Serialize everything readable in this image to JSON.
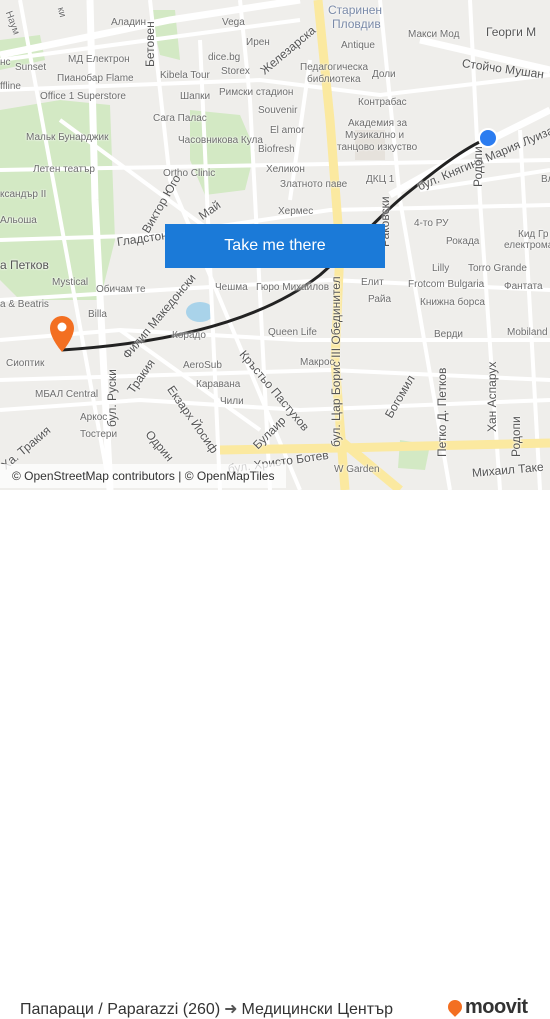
{
  "map": {
    "labels": {
      "naum": "Наум",
      "aladin": "Аладин",
      "betoven": "Бетовен",
      "vega": "Vega",
      "iren": "Ирен",
      "starinen": "Старинен",
      "plovdiv": "Пловдив",
      "maksi": "Макси Мод",
      "georgi": "Георги М",
      "stoycho": "Стойчо Мушан",
      "md": "МД Електрон",
      "sunset": "Sunset",
      "pianobar": "Пианобар Flame",
      "kibela": "Kibela Tour",
      "dice": "dice.bg",
      "storex": "Storex",
      "zhelezarska": "Железарска",
      "antique": "Antique",
      "ped1": "Педагогическа",
      "ped2": "библиотека",
      "doli": "Доли",
      "office1": "Office 1 Superstore",
      "shapki": "Шапки",
      "rimski": "Римски стадион",
      "souvenir": "Souvenir",
      "kontrabas": "Контрабас",
      "saga": "Сага Палас",
      "akad1": "Академия за",
      "akad2": "Музикално и",
      "akad3": "танцово изкуство",
      "malak": "Мальк Бунарджик",
      "chasovnikova": "Часовникова Кула",
      "elamor": "El amor",
      "biofresh": "Biofresh",
      "leten": "Летен театър",
      "ortho": "Ortho Clinic",
      "helikon": "Хеликон",
      "zlatnoto": "Златното паве",
      "dkc": "ДКЦ 1",
      "knyaginya": "бул. Княгиня Мария Луиза",
      "rodopi1": "Родопи",
      "viktor": "Виктор Юго",
      "may": "Май",
      "hermes": "Хермес",
      "gladston": "Гладстон",
      "petkov": "а Петков",
      "rakovski": "Раковски",
      "ru4": "4-то РУ",
      "rokada": "Рокада",
      "kid": "Кид Гр",
      "elektroma": "електрома",
      "mystical": "Mystical",
      "obicham": "Обичам те",
      "cheshma": "Чешма",
      "gyuro": "Гюро Михайлов",
      "elit": "Елит",
      "frotcom": "Frotcom Bulgaria",
      "lilly": "Lilly",
      "torro": "Torro Grande",
      "fantata": "Фантата",
      "raya": "Райа",
      "knizhna": "Книжна борса",
      "beatris": "а & Beatris",
      "billa": "Billa",
      "filip": "Филип Македонски",
      "queen": "Queen Life",
      "verdi": "Верди",
      "mobiland": "Mobiland",
      "trakia": "Тракия",
      "korado": "Корадо",
      "krastyo": "Кръстьо Пастухов",
      "sioptik": "Сиоптик",
      "aerosub": "AeroSub",
      "makros": "Макрос",
      "bogomil": "Богомил",
      "petkod": "Петко Д. Петков",
      "hanasparuh": "Хан Аспарух",
      "karavana": "Каравана",
      "chili": "Чили",
      "mbal": "МБАЛ Central",
      "arkos": "Аркос",
      "tosteri": "Тостери",
      "ruski": "бул. Руски",
      "ekzarh": "Екзарх Йосиф",
      "bulair": "Булаир",
      "odrin": "Одрин",
      "carboris": "бул. Цар Борис III Обединител",
      "hatrakia": "Ха. Тракия",
      "rodopi2": "Родопи",
      "mihail": "Михаил Таке",
      "botev": "бул. Христо Ботев",
      "wgarden": "W Garden",
      "ki": "ки",
      "ns": "нс",
      "affline": "ffline",
      "aleksandar": "ксандър II",
      "alsha": "Альоша",
      "rodopi_b": "Вл"
    },
    "cta_label": "Take me there",
    "attribution": "© OpenStreetMap contributors | © OpenMapTiles",
    "colors": {
      "route": "#222222",
      "origin_marker": "#f36f21",
      "destination_marker": "#2b7cf0",
      "button": "#1b7ad8",
      "major_road": "#fbe9a0",
      "park": "#d3e9c4"
    }
  },
  "footer": {
    "origin": "Папараци / Paparazzi (260)",
    "destination": "Медицински Център",
    "brand": "moovit"
  }
}
